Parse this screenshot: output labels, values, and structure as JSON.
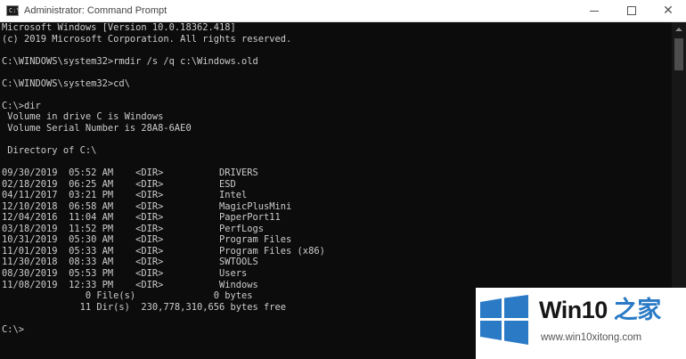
{
  "window": {
    "title": "Administrator: Command Prompt",
    "controls": {
      "minimize": "minimize",
      "maximize": "maximize",
      "close": "close"
    }
  },
  "console": {
    "lines": [
      "Microsoft Windows [Version 10.0.18362.418]",
      "(c) 2019 Microsoft Corporation. All rights reserved.",
      "",
      "C:\\WINDOWS\\system32>rmdir /s /q c:\\Windows.old",
      "",
      "C:\\WINDOWS\\system32>cd\\",
      "",
      "C:\\>dir",
      " Volume in drive C is Windows",
      " Volume Serial Number is 28A8-6AE0",
      "",
      " Directory of C:\\",
      "",
      "09/30/2019  05:52 AM    <DIR>          DRIVERS",
      "02/18/2019  06:25 AM    <DIR>          ESD",
      "04/11/2017  03:21 PM    <DIR>          Intel",
      "12/10/2018  06:58 AM    <DIR>          MagicPlusMini",
      "12/04/2016  11:04 AM    <DIR>          PaperPort11",
      "03/18/2019  11:52 PM    <DIR>          PerfLogs",
      "10/31/2019  05:30 AM    <DIR>          Program Files",
      "11/01/2019  05:33 AM    <DIR>          Program Files (x86)",
      "11/30/2018  08:33 AM    <DIR>          SWTOOLS",
      "08/30/2019  05:53 PM    <DIR>          Users",
      "11/08/2019  12:33 PM    <DIR>          Windows",
      "               0 File(s)              0 bytes",
      "              11 Dir(s)  230,778,310,656 bytes free",
      "",
      "C:\\>"
    ]
  },
  "watermark": {
    "brand_part_a": "Win10",
    "brand_part_b": " 之家",
    "url": "www.win10xitong.com"
  },
  "colors": {
    "console_background": "#0c0c0c",
    "console_text": "#cccccc",
    "brand_blue": "#2a7ac6"
  },
  "icons": [
    "cmd-app-icon",
    "minimize-icon",
    "maximize-icon",
    "close-icon",
    "scroll-up-arrow-icon",
    "windows-logo-icon"
  ]
}
